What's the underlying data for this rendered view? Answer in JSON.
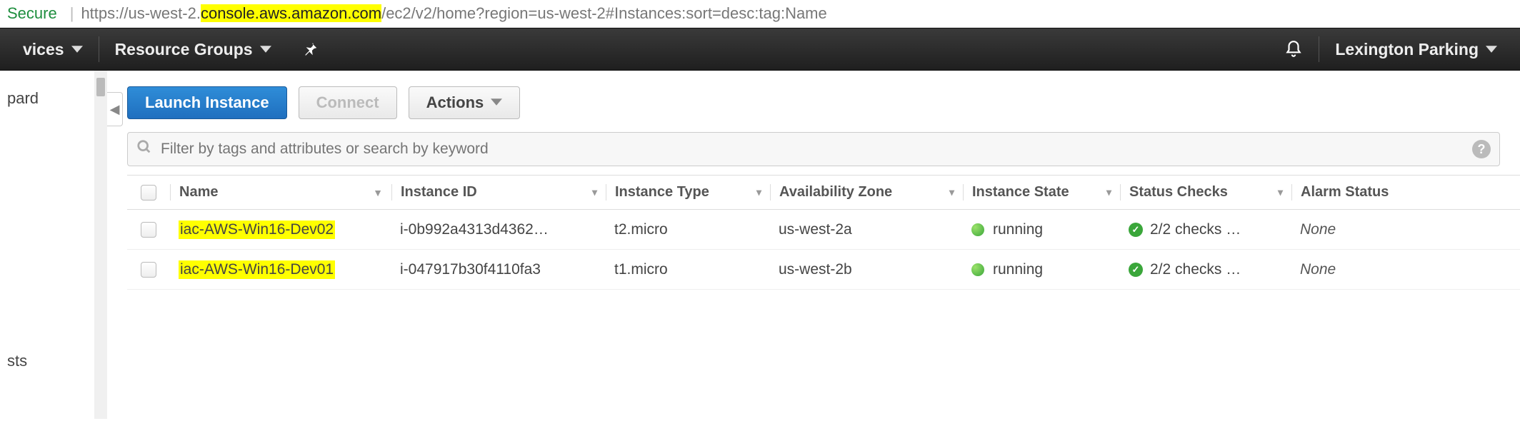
{
  "url": {
    "secure_label": "Secure",
    "proto": "https",
    "sub": "://us-west-2.",
    "host_hl": "console.aws.amazon.com",
    "path": "/ec2/v2/home?region=us-west-2#Instances:sort=desc:tag:Name"
  },
  "nav": {
    "services": "vices",
    "resource_groups": "Resource Groups",
    "account": "Lexington Parking"
  },
  "sidebar": {
    "items": [
      "pard",
      "sts"
    ]
  },
  "actions": {
    "launch": "Launch Instance",
    "connect": "Connect",
    "actions": "Actions"
  },
  "filter": {
    "placeholder": "Filter by tags and attributes or search by keyword"
  },
  "table": {
    "columns": [
      "Name",
      "Instance ID",
      "Instance Type",
      "Availability Zone",
      "Instance State",
      "Status Checks",
      "Alarm Status"
    ],
    "rows": [
      {
        "name": "iac-AWS-Win16-Dev02",
        "id": "i-0b992a4313d4362…",
        "type": "t2.micro",
        "az": "us-west-2a",
        "state": "running",
        "checks": "2/2 checks …",
        "alarm": "None"
      },
      {
        "name": "iac-AWS-Win16-Dev01",
        "id": "i-047917b30f4110fa3",
        "type": "t1.micro",
        "az": "us-west-2b",
        "state": "running",
        "checks": "2/2 checks …",
        "alarm": "None"
      }
    ]
  }
}
